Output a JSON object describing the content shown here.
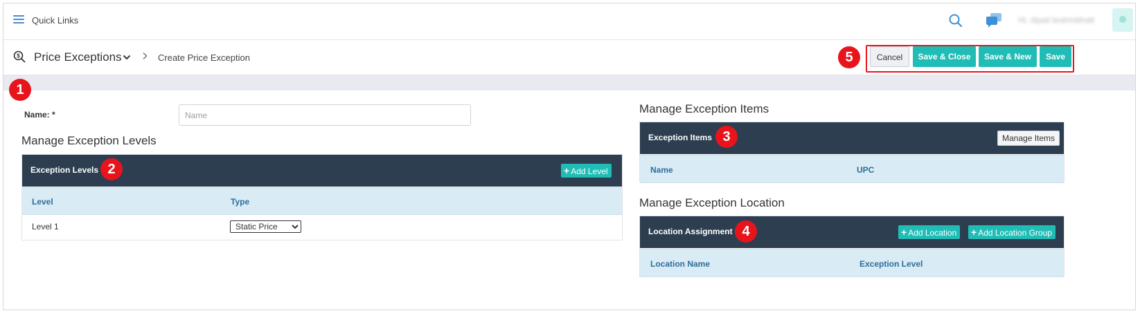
{
  "topbar": {
    "quick_links": "Quick Links",
    "user_name": "Hi, dipali brahmbhatt"
  },
  "breadcrumb": {
    "module": "Price Exceptions",
    "current": "Create Price Exception"
  },
  "actions": {
    "cancel": "Cancel",
    "save_close": "Save & Close",
    "save_new": "Save & New",
    "save": "Save"
  },
  "badges": [
    "1",
    "2",
    "3",
    "4",
    "5"
  ],
  "form": {
    "name_label": "Name: *",
    "name_value": "",
    "name_placeholder": "Name"
  },
  "levels": {
    "section_title": "Manage Exception Levels",
    "panel_title": "Exception Levels",
    "add_label": "Add Level",
    "columns": [
      "Level",
      "Type"
    ],
    "rows": [
      {
        "level": "Level 1",
        "type": "Static Price"
      }
    ],
    "type_options": [
      "Static Price"
    ]
  },
  "items": {
    "section_title": "Manage Exception Items",
    "panel_title": "Exception Items",
    "manage_label": "Manage Items",
    "columns": [
      "Name",
      "UPC"
    ]
  },
  "location": {
    "section_title": "Manage Exception Location",
    "panel_title": "Location Assignment",
    "add_location": "Add Location",
    "add_group": "Add Location Group",
    "columns": [
      "Location Name",
      "Exception Level"
    ]
  },
  "colors": {
    "header_dark": "#2c3e50",
    "teal": "#1fbdb5",
    "column_head_bg": "#d9ebf5",
    "annotation_red": "#e8141c"
  }
}
